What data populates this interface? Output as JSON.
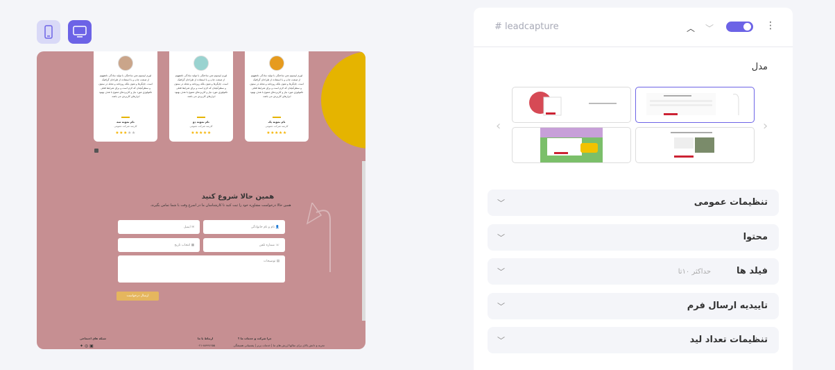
{
  "preview": {
    "testimonials": [
      {
        "name": "نام نمونه یک",
        "role": "کارمند شرکت عمومی",
        "text": "لورم ایپسوم متن ساختگی با تولید سادگی نامفهوم از صنعت چاپ و با استفاده از طراحان گرافیک است. چاپگرها و متون بلکه روزنامه و مجله در ستون و سطرآنچنان که لازم است و برای شرایط فعلی تکنولوژی مورد نیاز و کاربردهای متنوع با هدف بهبود ابزارهای کاربردی می باشد.",
        "stars": "★★★★★",
        "grey_stars": ""
      },
      {
        "name": "نام نمونه دو",
        "role": "کارمند شرکت عمومی",
        "text": "لورم ایپسوم متن ساختگی با تولید سادگی نامفهوم از صنعت چاپ و با استفاده از طراحان گرافیک است. چاپگرها و متون بلکه روزنامه و مجله در ستون و سطرآنچنان که لازم است و برای شرایط فعلی تکنولوژی مورد نیاز و کاربردهای متنوع با هدف بهبود ابزارهای کاربردی می باشد.",
        "stars": "★★★★★",
        "grey_stars": ""
      },
      {
        "name": "نام نمونه سه",
        "role": "کارمند شرکت عمومی",
        "text": "لورم ایپسوم متن ساختگی با تولید سادگی نامفهوم از صنعت چاپ و با استفاده از طراحان گرافیک است. چاپگرها و متون بلکه روزنامه و مجله در ستون و سطرآنچنان که لازم است و برای شرایط فعلی تکنولوژی مورد نیاز و کاربردهای متنوع با هدف بهبود ابزارهای کاربردی می باشد.",
        "stars": "★★★",
        "grey_stars": "★★"
      }
    ],
    "form": {
      "title": "همین حالا شروع کنید",
      "subtitle": "همین حالا درخواست مشاوره خود را ثبت کنید تا کارشناسان ما در اسرع وقت با شما تماس بگیرند.",
      "name_placeholder": "نام و نام خانوادگی",
      "email_placeholder": "ایمیل",
      "phone_placeholder": "شماره تلفن",
      "date_placeholder": "انتخاب تاریخ",
      "desc_placeholder": "توضیحات",
      "submit_label": "ارسال درخواست"
    },
    "footer": {
      "col1_title": "چرا شرکت و خدمات ما ؟",
      "col1_text": "تجربه و دانش بالای برای سالها ارزش های ما | خدمات برتر | پشتیبانی همیشگی",
      "col2_title": "ارتباط با ما",
      "col2_text": "۰۲۱-۸۸۹۹۶۶۵۵",
      "col3_title": "شبکه های اجتماعی"
    }
  },
  "device": {
    "mobile_icon": "mobile-icon",
    "desktop_icon": "desktop-icon"
  },
  "panel": {
    "tag": "# leadcapture",
    "model_label": "مدل",
    "sections": [
      {
        "title": "تنظیمات عمومی",
        "sub": ""
      },
      {
        "title": "محتوا",
        "sub": ""
      },
      {
        "title": "فیلد ها",
        "sub": "حداکثر ۱۰تا"
      },
      {
        "title": "تاییدیه ارسال فرم",
        "sub": ""
      },
      {
        "title": "تنظیمات تعداد لید",
        "sub": ""
      }
    ]
  },
  "colors": {
    "accent": "#6c63e6",
    "preview_bg": "#c68f92",
    "yellow": "#e5b400"
  }
}
